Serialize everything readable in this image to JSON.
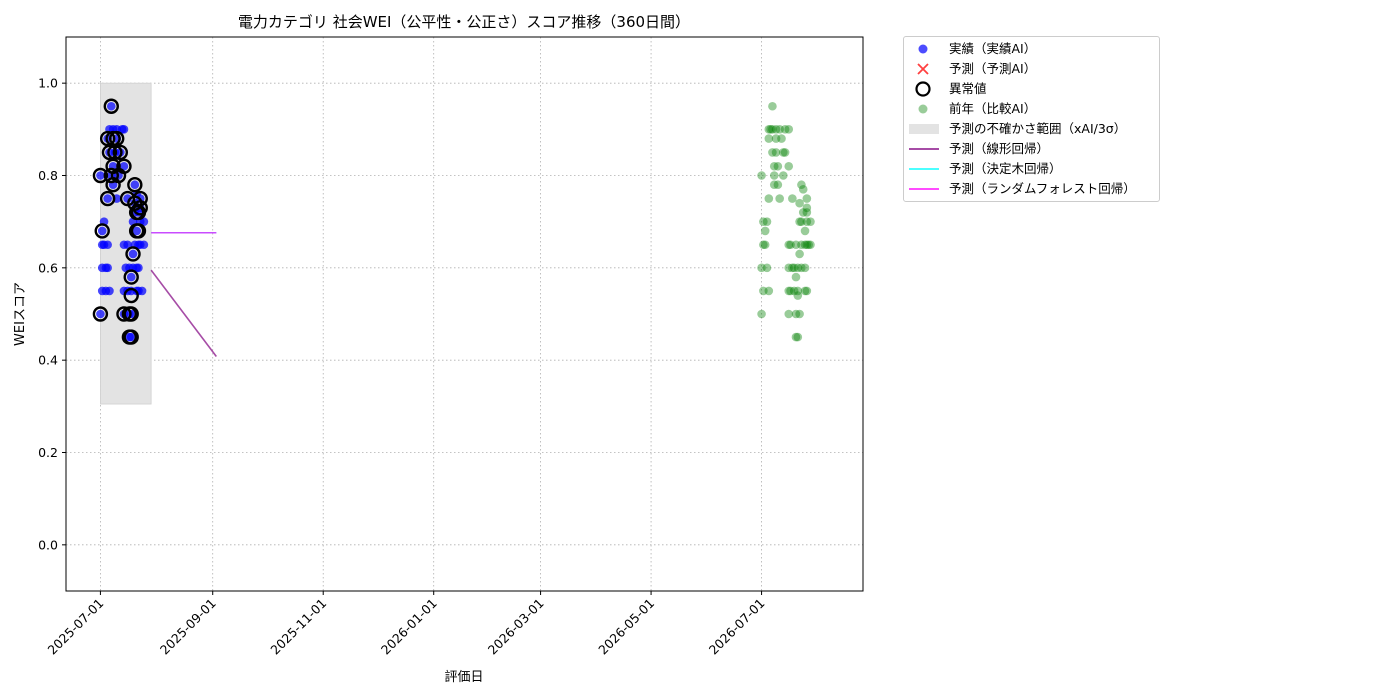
{
  "chart_data": {
    "type": "scatter",
    "title": "電力カテゴリ 社会WEI（公平性・公正さ）スコア推移（360日間）",
    "xlabel": "評価日",
    "ylabel": "WEIスコア",
    "x_ticks": [
      "2025-07-01",
      "2025-09-01",
      "2025-11-01",
      "2026-01-01",
      "2026-03-01",
      "2026-05-01",
      "2026-07-01"
    ],
    "y_ticks": [
      "0.0",
      "0.2",
      "0.4",
      "0.6",
      "0.8",
      "1.0"
    ],
    "xlim": [
      "2025-06-12",
      "2026-08-26"
    ],
    "ylim": [
      -0.1,
      1.1
    ],
    "grid": true,
    "legend_position": "outside-top-right",
    "series": [
      {
        "name": "実績（実績AI）",
        "kind": "scatter",
        "color": "#0000ff",
        "points": [
          [
            "2025-07-01",
            0.5
          ],
          [
            "2025-07-01",
            0.8
          ],
          [
            "2025-07-02",
            0.65
          ],
          [
            "2025-07-02",
            0.6
          ],
          [
            "2025-07-02",
            0.55
          ],
          [
            "2025-07-02",
            0.68
          ],
          [
            "2025-07-03",
            0.7
          ],
          [
            "2025-07-03",
            0.65
          ],
          [
            "2025-07-04",
            0.6
          ],
          [
            "2025-07-04",
            0.55
          ],
          [
            "2025-07-05",
            0.88
          ],
          [
            "2025-07-05",
            0.75
          ],
          [
            "2025-07-05",
            0.65
          ],
          [
            "2025-07-05",
            0.6
          ],
          [
            "2025-07-06",
            0.9
          ],
          [
            "2025-07-06",
            0.85
          ],
          [
            "2025-07-06",
            0.55
          ],
          [
            "2025-07-07",
            0.95
          ],
          [
            "2025-07-07",
            0.8
          ],
          [
            "2025-07-08",
            0.9
          ],
          [
            "2025-07-08",
            0.78
          ],
          [
            "2025-07-08",
            0.82
          ],
          [
            "2025-07-09",
            0.85
          ],
          [
            "2025-07-10",
            0.9
          ],
          [
            "2025-07-10",
            0.88
          ],
          [
            "2025-07-10",
            0.75
          ],
          [
            "2025-07-11",
            0.8
          ],
          [
            "2025-07-12",
            0.85
          ],
          [
            "2025-07-13",
            0.9
          ],
          [
            "2025-07-14",
            0.82
          ],
          [
            "2025-07-14",
            0.9
          ],
          [
            "2025-07-14",
            0.65
          ],
          [
            "2025-07-14",
            0.55
          ],
          [
            "2025-07-14",
            0.5
          ],
          [
            "2025-07-15",
            0.6
          ],
          [
            "2025-07-16",
            0.75
          ],
          [
            "2025-07-16",
            0.55
          ],
          [
            "2025-07-16",
            0.65
          ],
          [
            "2025-07-17",
            0.45
          ],
          [
            "2025-07-17",
            0.6
          ],
          [
            "2025-07-17",
            0.5
          ],
          [
            "2025-07-18",
            0.58
          ],
          [
            "2025-07-18",
            0.55
          ],
          [
            "2025-07-18",
            0.45
          ],
          [
            "2025-07-19",
            0.63
          ],
          [
            "2025-07-19",
            0.7
          ],
          [
            "2025-07-19",
            0.6
          ],
          [
            "2025-07-19",
            0.5
          ],
          [
            "2025-07-20",
            0.65
          ],
          [
            "2025-07-20",
            0.78
          ],
          [
            "2025-07-20",
            0.74
          ],
          [
            "2025-07-20",
            0.72
          ],
          [
            "2025-07-21",
            0.55
          ],
          [
            "2025-07-21",
            0.6
          ],
          [
            "2025-07-21",
            0.68
          ],
          [
            "2025-07-21",
            0.76
          ],
          [
            "2025-07-22",
            0.72
          ],
          [
            "2025-07-22",
            0.65
          ],
          [
            "2025-07-22",
            0.6
          ],
          [
            "2025-07-22",
            0.55
          ],
          [
            "2025-07-23",
            0.75
          ],
          [
            "2025-07-23",
            0.7
          ],
          [
            "2025-07-23",
            0.73
          ],
          [
            "2025-07-23",
            0.65
          ],
          [
            "2025-07-24",
            0.55
          ],
          [
            "2025-07-25",
            0.7
          ],
          [
            "2025-07-25",
            0.65
          ]
        ]
      },
      {
        "name": "予測（予測AI）",
        "kind": "scatter",
        "color": "#ff0000",
        "points": []
      },
      {
        "name": "異常値",
        "kind": "scatter",
        "color": "#000000",
        "points": [
          [
            "2025-07-01",
            0.5
          ],
          [
            "2025-07-01",
            0.8
          ],
          [
            "2025-07-02",
            0.68
          ],
          [
            "2025-07-05",
            0.75
          ],
          [
            "2025-07-05",
            0.88
          ],
          [
            "2025-07-06",
            0.85
          ],
          [
            "2025-07-07",
            0.95
          ],
          [
            "2025-07-07",
            0.8
          ],
          [
            "2025-07-08",
            0.78
          ],
          [
            "2025-07-08",
            0.82
          ],
          [
            "2025-07-08",
            0.88
          ],
          [
            "2025-07-09",
            0.85
          ],
          [
            "2025-07-10",
            0.88
          ],
          [
            "2025-07-11",
            0.8
          ],
          [
            "2025-07-12",
            0.85
          ],
          [
            "2025-07-14",
            0.82
          ],
          [
            "2025-07-14",
            0.5
          ],
          [
            "2025-07-16",
            0.75
          ],
          [
            "2025-07-17",
            0.45
          ],
          [
            "2025-07-17",
            0.5
          ],
          [
            "2025-07-18",
            0.58
          ],
          [
            "2025-07-18",
            0.54
          ],
          [
            "2025-07-18",
            0.5
          ],
          [
            "2025-07-18",
            0.45
          ],
          [
            "2025-07-19",
            0.63
          ],
          [
            "2025-07-20",
            0.74
          ],
          [
            "2025-07-20",
            0.78
          ],
          [
            "2025-07-21",
            0.68
          ],
          [
            "2025-07-21",
            0.72
          ],
          [
            "2025-07-22",
            0.72
          ],
          [
            "2025-07-22",
            0.68
          ],
          [
            "2025-07-23",
            0.75
          ],
          [
            "2025-07-23",
            0.73
          ]
        ]
      },
      {
        "name": "前年（比較AI）",
        "kind": "scatter",
        "color": "#008000",
        "points": [
          [
            "2026-07-01",
            0.5
          ],
          [
            "2026-07-01",
            0.6
          ],
          [
            "2026-07-01",
            0.8
          ],
          [
            "2026-07-02",
            0.55
          ],
          [
            "2026-07-02",
            0.65
          ],
          [
            "2026-07-02",
            0.7
          ],
          [
            "2026-07-03",
            0.68
          ],
          [
            "2026-07-03",
            0.65
          ],
          [
            "2026-07-04",
            0.6
          ],
          [
            "2026-07-04",
            0.7
          ],
          [
            "2026-07-05",
            0.55
          ],
          [
            "2026-07-05",
            0.75
          ],
          [
            "2026-07-05",
            0.88
          ],
          [
            "2026-07-05",
            0.9
          ],
          [
            "2026-07-06",
            0.9
          ],
          [
            "2026-07-07",
            0.95
          ],
          [
            "2026-07-07",
            0.9
          ],
          [
            "2026-07-07",
            0.85
          ],
          [
            "2026-07-08",
            0.82
          ],
          [
            "2026-07-08",
            0.8
          ],
          [
            "2026-07-08",
            0.78
          ],
          [
            "2026-07-09",
            0.9
          ],
          [
            "2026-07-09",
            0.88
          ],
          [
            "2026-07-09",
            0.85
          ],
          [
            "2026-07-10",
            0.82
          ],
          [
            "2026-07-10",
            0.78
          ],
          [
            "2026-07-11",
            0.75
          ],
          [
            "2026-07-11",
            0.9
          ],
          [
            "2026-07-12",
            0.88
          ],
          [
            "2026-07-13",
            0.8
          ],
          [
            "2026-07-13",
            0.85
          ],
          [
            "2026-07-14",
            0.9
          ],
          [
            "2026-07-14",
            0.85
          ],
          [
            "2026-07-16",
            0.9
          ],
          [
            "2026-07-16",
            0.82
          ],
          [
            "2026-07-16",
            0.65
          ],
          [
            "2026-07-16",
            0.6
          ],
          [
            "2026-07-16",
            0.55
          ],
          [
            "2026-07-16",
            0.5
          ],
          [
            "2026-07-17",
            0.65
          ],
          [
            "2026-07-17",
            0.55
          ],
          [
            "2026-07-18",
            0.75
          ],
          [
            "2026-07-18",
            0.6
          ],
          [
            "2026-07-19",
            0.6
          ],
          [
            "2026-07-19",
            0.55
          ],
          [
            "2026-07-20",
            0.65
          ],
          [
            "2026-07-20",
            0.58
          ],
          [
            "2026-07-20",
            0.5
          ],
          [
            "2026-07-20",
            0.45
          ],
          [
            "2026-07-21",
            0.45
          ],
          [
            "2026-07-21",
            0.6
          ],
          [
            "2026-07-21",
            0.55
          ],
          [
            "2026-07-21",
            0.54
          ],
          [
            "2026-07-22",
            0.63
          ],
          [
            "2026-07-22",
            0.5
          ],
          [
            "2026-07-22",
            0.7
          ],
          [
            "2026-07-22",
            0.74
          ],
          [
            "2026-07-23",
            0.6
          ],
          [
            "2026-07-23",
            0.65
          ],
          [
            "2026-07-23",
            0.7
          ],
          [
            "2026-07-23",
            0.78
          ],
          [
            "2026-07-24",
            0.77
          ],
          [
            "2026-07-24",
            0.72
          ],
          [
            "2026-07-25",
            0.68
          ],
          [
            "2026-07-25",
            0.65
          ],
          [
            "2026-07-25",
            0.6
          ],
          [
            "2026-07-25",
            0.55
          ],
          [
            "2026-07-26",
            0.73
          ],
          [
            "2026-07-26",
            0.75
          ],
          [
            "2026-07-26",
            0.7
          ],
          [
            "2026-07-26",
            0.72
          ],
          [
            "2026-07-26",
            0.55
          ],
          [
            "2026-07-26",
            0.65
          ],
          [
            "2026-07-27",
            0.65
          ],
          [
            "2026-07-28",
            0.7
          ],
          [
            "2026-07-28",
            0.65
          ]
        ]
      },
      {
        "name": "予測の不確かさ範囲（xAI/3σ）",
        "kind": "band",
        "color": "#e3e3e3",
        "x_range": [
          "2025-07-01",
          "2025-07-29"
        ],
        "y_range": [
          0.305,
          1.0
        ]
      },
      {
        "name": "予測（線形回帰）",
        "kind": "line",
        "color": "#800080",
        "points": [
          [
            "2025-07-29",
            0.595
          ],
          [
            "2025-09-03",
            0.408
          ]
        ]
      },
      {
        "name": "予測（決定木回帰）",
        "kind": "line",
        "color": "#00ffff",
        "points": [
          [
            "2025-07-29",
            0.676
          ],
          [
            "2025-09-03",
            0.676
          ]
        ]
      },
      {
        "name": "予測（ランダムフォレスト回帰）",
        "kind": "line",
        "color": "#ff00ff",
        "points": [
          [
            "2025-07-29",
            0.676
          ],
          [
            "2025-09-03",
            0.676
          ]
        ]
      }
    ]
  }
}
